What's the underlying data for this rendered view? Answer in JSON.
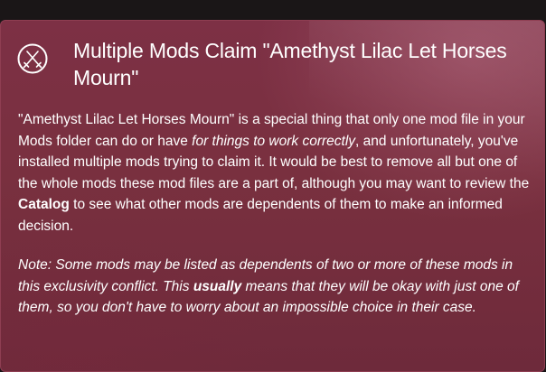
{
  "dialog": {
    "title": "Multiple Mods Claim \"Amethyst Lilac Let Horses Mourn\"",
    "icon": "crossed-swords-icon",
    "paragraph1": {
      "part1": "\"Amethyst Lilac Let Horses Mourn\" is a special thing that only one mod file in your Mods folder can do or have ",
      "emphasis1": "for things to work correctly",
      "part2": ", and unfortunately, you've installed multiple mods trying to claim it. It would be best to remove all but one of the whole mods these mod files are a part of, although you may want to review the ",
      "catalog_link": "Catalog",
      "part3": " to see what other mods are dependents of them to make an informed decision."
    },
    "paragraph2": {
      "part1": "Note: Some mods may be listed as dependents of two or more of these mods in this exclusivity conflict. This ",
      "emphasis": "usually",
      "part2": " means that they will be okay with just one of them, so you don't have to worry about an impossible choice in their case."
    }
  },
  "colors": {
    "card_background": "#7a2f42",
    "card_border": "#8f3e52",
    "text": "#ffffff",
    "page_background": "#1a1617"
  }
}
